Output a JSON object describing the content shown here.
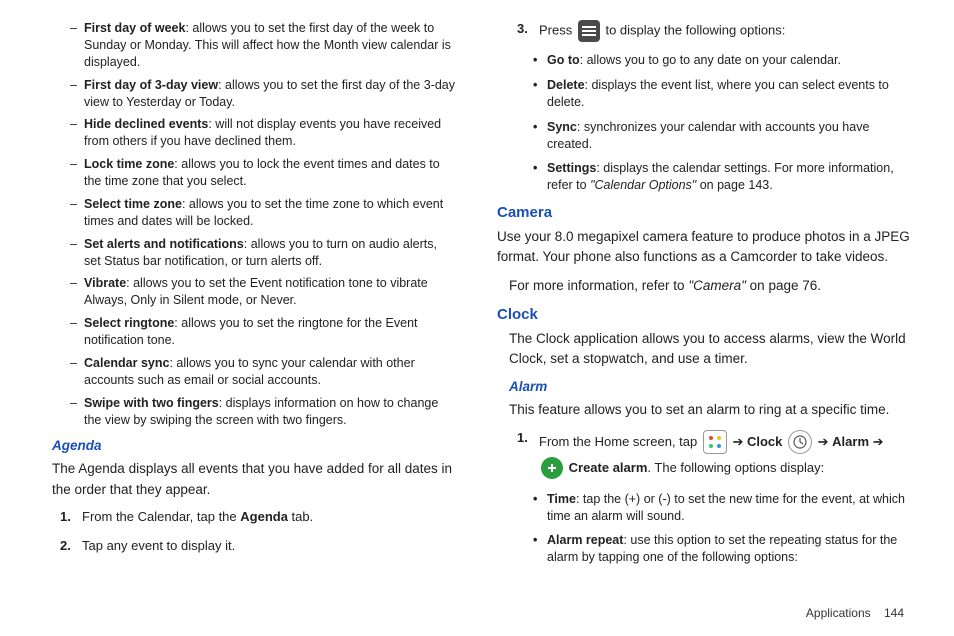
{
  "left": {
    "dashes": [
      {
        "term": "First day of week",
        "desc": ": allows you to set the first day of the week to Sunday or Monday. This will affect how the Month view calendar is displayed."
      },
      {
        "term": "First day of 3-day view",
        "desc": ": allows you to set the first day of the 3-day view to Yesterday or Today."
      },
      {
        "term": "Hide declined events",
        "desc": ": will not display events you have received from others if you have declined them."
      },
      {
        "term": "Lock time zone",
        "desc": ": allows you to lock the event times and dates to the time zone that you select."
      },
      {
        "term": "Select time zone",
        "desc": ": allows you to set the time zone to which event times and dates will be locked."
      },
      {
        "term": "Set alerts and notifications",
        "desc": ": allows you to turn on audio alerts, set Status bar notification, or turn alerts off."
      },
      {
        "term": "Vibrate",
        "desc": ": allows you to set the Event notification tone to vibrate Always, Only in Silent mode, or Never."
      },
      {
        "term": "Select ringtone",
        "desc": ": allows you to set the ringtone for the Event notification tone."
      },
      {
        "term": "Calendar sync",
        "desc": ": allows you to sync your calendar with other accounts such as email or social accounts."
      },
      {
        "term": "Swipe with two fingers",
        "desc": ": displays information on how to change the view by swiping the screen with two fingers."
      }
    ],
    "agenda": {
      "head": "Agenda",
      "intro": "The Agenda displays all events that you have added for all dates in the order that they appear.",
      "step1_pre": "From the Calendar, tap the ",
      "step1_bold": "Agenda",
      "step1_post": " tab.",
      "step2": "Tap any event to display it."
    }
  },
  "right": {
    "step3": {
      "pre": "Press ",
      "post": " to display the following options:"
    },
    "bullets3": [
      {
        "term": "Go to",
        "desc": ": allows you to go to any date on your calendar."
      },
      {
        "term": "Delete",
        "desc": ": displays the event list, where you can select events to delete."
      },
      {
        "term": "Sync",
        "desc": ": synchronizes your calendar with accounts you have created."
      }
    ],
    "settings": {
      "term": "Settings",
      "desc_pre": ": displays the calendar settings. For more information, refer to ",
      "desc_ital": "\"Calendar Options\"",
      "desc_post": " on page 143."
    },
    "camera": {
      "head": "Camera",
      "p1": "Use your 8.0 megapixel camera feature to produce photos in a JPEG format. Your phone also functions as a Camcorder to take videos.",
      "p2_pre": "For more information, refer to ",
      "p2_ital": "\"Camera\"",
      "p2_post": " on page 76."
    },
    "clock": {
      "head": "Clock",
      "p1": "The Clock application allows you to access alarms, view the World Clock, set a stopwatch, and use a timer."
    },
    "alarm": {
      "head": "Alarm",
      "intro": "This feature allows you to set an alarm to ring at a specific time.",
      "step1": {
        "pre": "From the Home screen, tap ",
        "arrow": " ➔ ",
        "clock": "Clock",
        "alarm": "Alarm",
        "create": "Create alarm",
        "post": ". The following options display:"
      },
      "bullets": [
        {
          "term": "Time",
          "desc": ": tap the (+) or (-) to set the new time for the event, at which time an alarm will sound."
        },
        {
          "term": "Alarm repeat",
          "desc": ": use this option to set the repeating status for the alarm by tapping one of the following options:"
        }
      ]
    }
  },
  "footer": {
    "section": "Applications",
    "page": "144"
  }
}
